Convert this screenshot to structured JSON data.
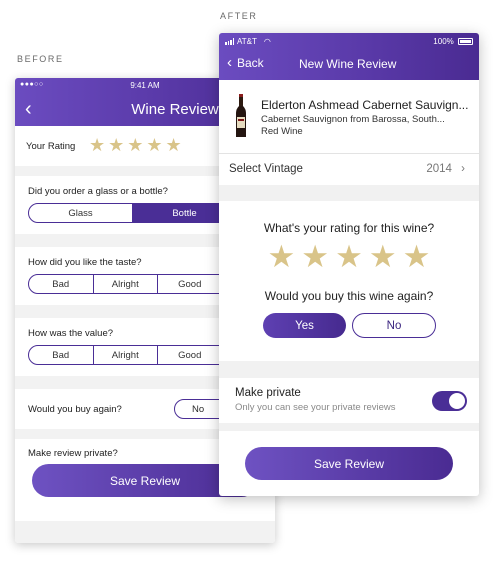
{
  "captions": {
    "before": "BEFORE",
    "after": "AFTER"
  },
  "before": {
    "status_time": "9:41 AM",
    "status_dots": "●●●○○",
    "title": "Wine Review",
    "rating_label": "Your Rating",
    "rating_stars": "★★★★★",
    "q_glass": "Did you order a glass or a bottle?",
    "glass_options": [
      "Glass",
      "Bottle"
    ],
    "q_taste": "How did you like the taste?",
    "taste_options": [
      "Bad",
      "Alright",
      "Good",
      ""
    ],
    "q_value": "How was the value?",
    "value_options": [
      "Bad",
      "Alright",
      "Good",
      ""
    ],
    "q_buy": "Would you buy again?",
    "buy_no": "No",
    "private_label": "Make review private?",
    "save_label": "Save Review"
  },
  "after": {
    "carrier": "AT&T",
    "battery": "100%",
    "back_label": "Back",
    "title": "New Wine Review",
    "wine_name": "Elderton Ashmead Cabernet Sauvign...",
    "wine_sub": "Cabernet Sauvignon from Barossa, South...",
    "wine_type": "Red Wine",
    "vintage_label": "Select Vintage",
    "vintage_value": "2014",
    "rating_q": "What's your rating for this wine?",
    "rating_stars": "★★★★★",
    "buy_q": "Would you buy this wine again?",
    "yes_label": "Yes",
    "no_label": "No",
    "private_title": "Make private",
    "private_sub": "Only you can see your private reviews",
    "private_on": true,
    "save_label": "Save Review"
  },
  "colors": {
    "accent": "#4a2e96",
    "star": "#d9c489"
  }
}
